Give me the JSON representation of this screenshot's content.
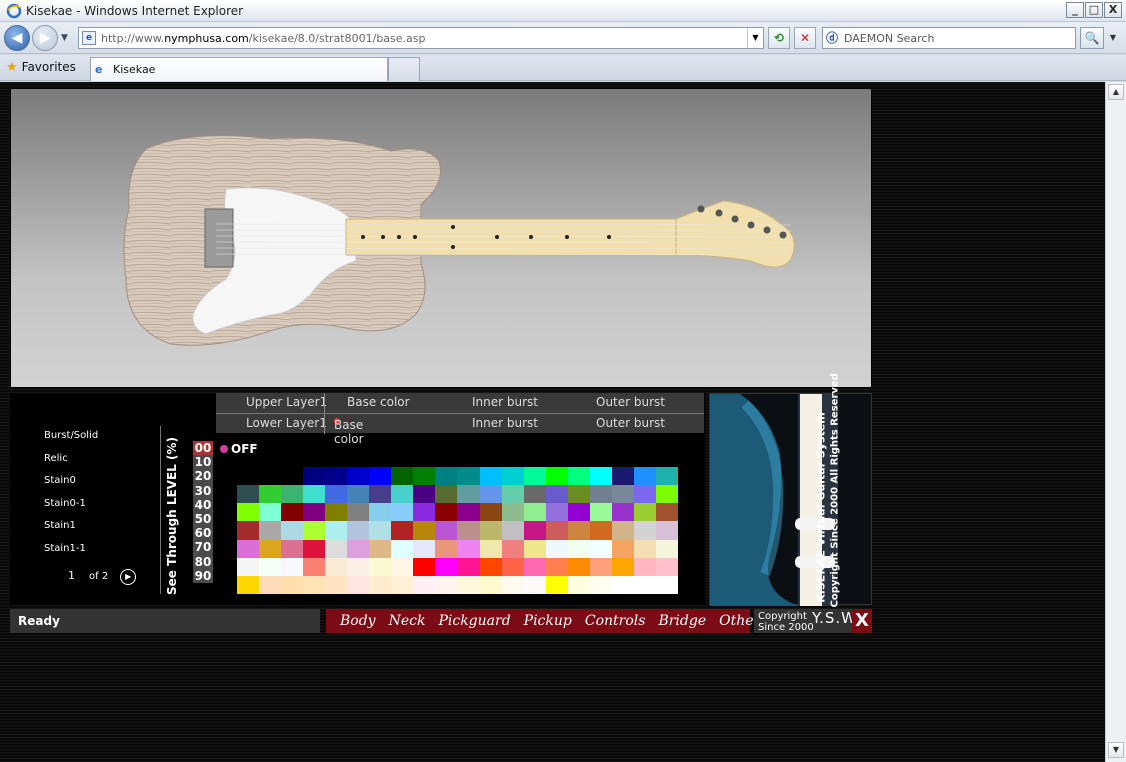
{
  "window": {
    "title": "Kisekae - Windows Internet Explorer",
    "min": "_",
    "max": "□",
    "close": "X"
  },
  "nav": {
    "back": "◀",
    "forward": "▶",
    "dropdown": "▼",
    "url_prefix": "http://www.",
    "url_domain": "nymphusa.com",
    "url_path": "/kisekae/8.0/strat8001/base.asp",
    "refresh": "⟲",
    "stop": "✕",
    "search_placeholder": "DAEMON Search",
    "search_btn": "🔍",
    "search_dd": "▼"
  },
  "tabs": {
    "favorites": "Favorites",
    "tab_label": "Kisekae"
  },
  "panel": {
    "menu": [
      "Burst/Solid",
      "Relic",
      "Stain0",
      "Stain0-1",
      "Stain1",
      "Stain1-1"
    ],
    "page_current": "1",
    "page_of": "of 2",
    "level_label": "See Through LEVEL (%)",
    "levels": [
      "00",
      "10",
      "20",
      "30",
      "40",
      "50",
      "60",
      "70",
      "80",
      "90"
    ],
    "off": "OFF",
    "upper": {
      "layer": "Upper Layer1",
      "base": "Base color",
      "inner": "Inner burst",
      "outer": "Outer burst"
    },
    "lower": {
      "layer": "Lower Layer1",
      "base": "Base color",
      "inner": "Inner burst",
      "outer": "Outer burst"
    }
  },
  "palette": [
    [
      "#000000",
      "#000000",
      "#000000",
      "#000080",
      "#00008b",
      "#0000cd",
      "#0000ff",
      "#006400",
      "#008000",
      "#008080",
      "#008b8b",
      "#00bfff",
      "#00ced1",
      "#00fa9a",
      "#00ff00",
      "#00ff7f",
      "#00ffff",
      "#191970",
      "#1e90ff",
      "#20b2aa"
    ],
    [
      "#2f4f4f",
      "#32cd32",
      "#3cb371",
      "#40e0d0",
      "#4169e1",
      "#4682b4",
      "#483d8b",
      "#48d1cc",
      "#4b0082",
      "#556b2f",
      "#5f9ea0",
      "#6495ed",
      "#66cdaa",
      "#696969",
      "#6a5acd",
      "#6b8e23",
      "#708090",
      "#778899",
      "#7b68ee",
      "#7cfc00"
    ],
    [
      "#7fff00",
      "#7fffd4",
      "#800000",
      "#800080",
      "#808000",
      "#808080",
      "#87ceeb",
      "#87cefa",
      "#8a2be2",
      "#8b0000",
      "#8b008b",
      "#8b4513",
      "#8fbc8f",
      "#90ee90",
      "#9370db",
      "#9400d3",
      "#98fb98",
      "#9932cc",
      "#9acd32",
      "#a0522d"
    ],
    [
      "#a52a2a",
      "#a9a9a9",
      "#add8e6",
      "#adff2f",
      "#afeeee",
      "#b0c4de",
      "#b0e0e6",
      "#b22222",
      "#b8860b",
      "#ba55d3",
      "#bc8f8f",
      "#bdb76b",
      "#c0c0c0",
      "#c71585",
      "#cd5c5c",
      "#cd853f",
      "#d2691e",
      "#d2b48c",
      "#d3d3d3",
      "#d8bfd8"
    ],
    [
      "#da70d6",
      "#daa520",
      "#db7093",
      "#dc143c",
      "#dcdcdc",
      "#dda0dd",
      "#deb887",
      "#e0ffff",
      "#e6e6fa",
      "#e9967a",
      "#ee82ee",
      "#eee8aa",
      "#f08080",
      "#f0e68c",
      "#f0f8ff",
      "#f0fff0",
      "#f0ffff",
      "#f4a460",
      "#f5deb3",
      "#f5f5dc"
    ],
    [
      "#f5f5f5",
      "#f5fffa",
      "#f8f8ff",
      "#fa8072",
      "#faebd7",
      "#faf0e6",
      "#fafad2",
      "#fdf5e6",
      "#ff0000",
      "#ff00ff",
      "#ff1493",
      "#ff4500",
      "#ff6347",
      "#ff69b4",
      "#ff7f50",
      "#ff8c00",
      "#ffa07a",
      "#ffa500",
      "#ffb6c1",
      "#ffc0cb"
    ],
    [
      "#ffd700",
      "#ffdab9",
      "#ffdead",
      "#ffe4b5",
      "#ffe4c4",
      "#ffe4e1",
      "#ffebcd",
      "#ffefd5",
      "#fff0f5",
      "#fff5ee",
      "#fff8dc",
      "#fffacd",
      "#fffaf0",
      "#fffafa",
      "#ffff00",
      "#ffffe0",
      "#fffff0",
      "#ffffff",
      "#ffffff",
      "#ffffff"
    ]
  ],
  "ad": {
    "line1": "KISEKAE Virtual Guitar System",
    "line2": "Copyright Since 2000 All Rights Reserved"
  },
  "status": "Ready",
  "bottom_nav": [
    "Body",
    "Neck",
    "Pickguard",
    "Pickup",
    "Controls",
    "Bridge",
    "Others"
  ],
  "copyright": {
    "line1": "Copyright",
    "line2": "Since 2000",
    "brand": "Y.S.W"
  },
  "close_label": "X",
  "colors": {
    "accent": "#7b0b14",
    "selected_level": "#aa3333"
  }
}
